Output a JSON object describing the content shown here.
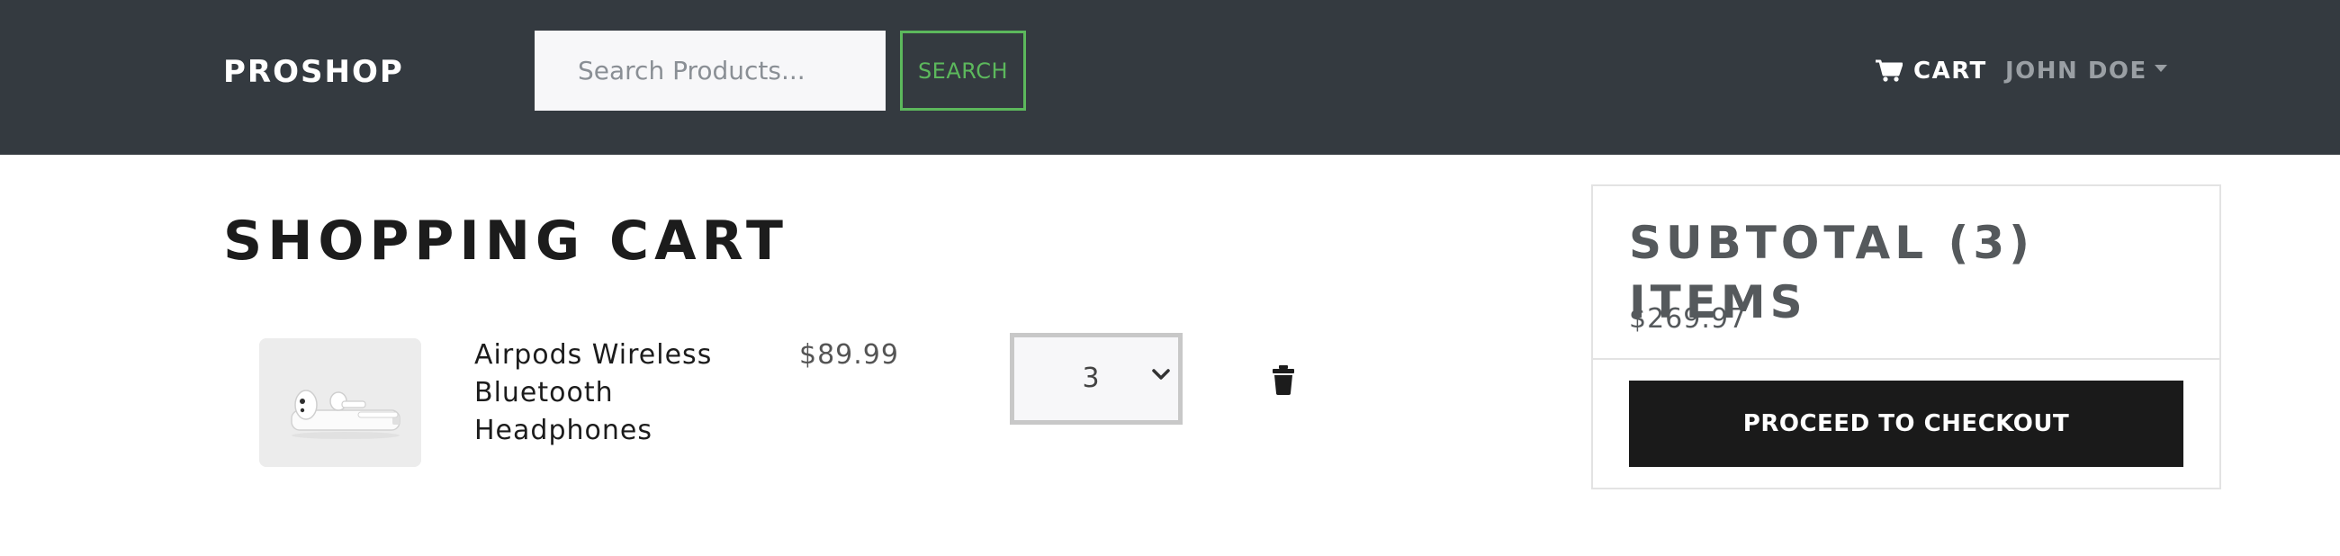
{
  "navbar": {
    "brand": "PROSHOP",
    "search": {
      "placeholder": "Search Products...",
      "button_label": "SEARCH"
    },
    "cart_label": "CART",
    "user_label": "JOHN DOE",
    "colors": {
      "background": "#343a40",
      "search_accent": "#5cb85c"
    }
  },
  "cart": {
    "title": "SHOPPING CART",
    "items": [
      {
        "image_icon": "airpods-product-image",
        "name": "Airpods Wireless Bluetooth Headphones",
        "price": "$89.99",
        "quantity": "3"
      }
    ]
  },
  "summary": {
    "title": "SUBTOTAL (3) ITEMS",
    "total": "$269.97",
    "checkout_label": "PROCEED TO CHECKOUT"
  }
}
